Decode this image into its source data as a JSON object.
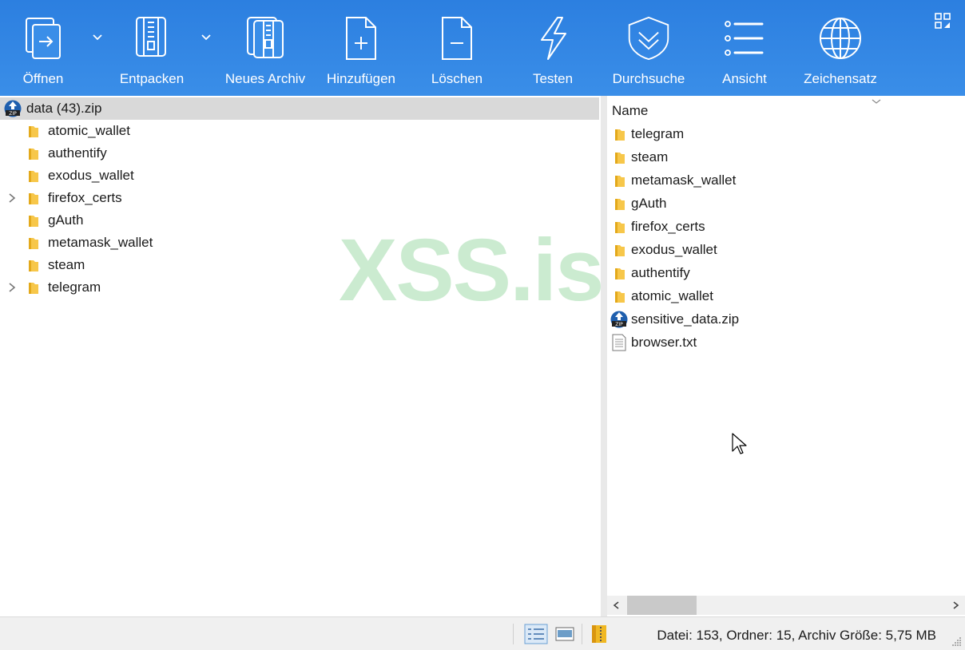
{
  "toolbar": {
    "buttons": [
      {
        "label": "Öffnen",
        "icon": "open-icon"
      },
      {
        "label": "Entpacken",
        "icon": "extract-icon"
      },
      {
        "label": "Neues Archiv",
        "icon": "new-archive-icon"
      },
      {
        "label": "Hinzufügen",
        "icon": "add-file-icon"
      },
      {
        "label": "Löschen",
        "icon": "delete-file-icon"
      },
      {
        "label": "Testen",
        "icon": "lightning-icon"
      },
      {
        "label": "Durchsuche",
        "icon": "shield-chevron-icon"
      },
      {
        "label": "Ansicht",
        "icon": "list-view-icon"
      },
      {
        "label": "Zeichensatz",
        "icon": "globe-icon"
      }
    ],
    "accent_color": "#2c7fe0"
  },
  "tree": {
    "root": "data (43).zip",
    "items": [
      {
        "label": "atomic_wallet",
        "expandable": false
      },
      {
        "label": "authentify",
        "expandable": false
      },
      {
        "label": "exodus_wallet",
        "expandable": false
      },
      {
        "label": "firefox_certs",
        "expandable": true
      },
      {
        "label": "gAuth",
        "expandable": false
      },
      {
        "label": "metamask_wallet",
        "expandable": false
      },
      {
        "label": "steam",
        "expandable": false
      },
      {
        "label": "telegram",
        "expandable": true
      }
    ]
  },
  "list": {
    "column_name": "Name",
    "items": [
      {
        "label": "telegram",
        "type": "folder"
      },
      {
        "label": "steam",
        "type": "folder"
      },
      {
        "label": "metamask_wallet",
        "type": "folder"
      },
      {
        "label": "gAuth",
        "type": "folder"
      },
      {
        "label": "firefox_certs",
        "type": "folder"
      },
      {
        "label": "exodus_wallet",
        "type": "folder"
      },
      {
        "label": "authentify",
        "type": "folder"
      },
      {
        "label": "atomic_wallet",
        "type": "folder"
      },
      {
        "label": "sensitive_data.zip",
        "type": "zip"
      },
      {
        "label": "browser.txt",
        "type": "text"
      }
    ]
  },
  "watermark": "XSS.is",
  "status": {
    "summary": "Datei: 153, Ordner: 15, Archiv Größe: 5,75 MB"
  }
}
